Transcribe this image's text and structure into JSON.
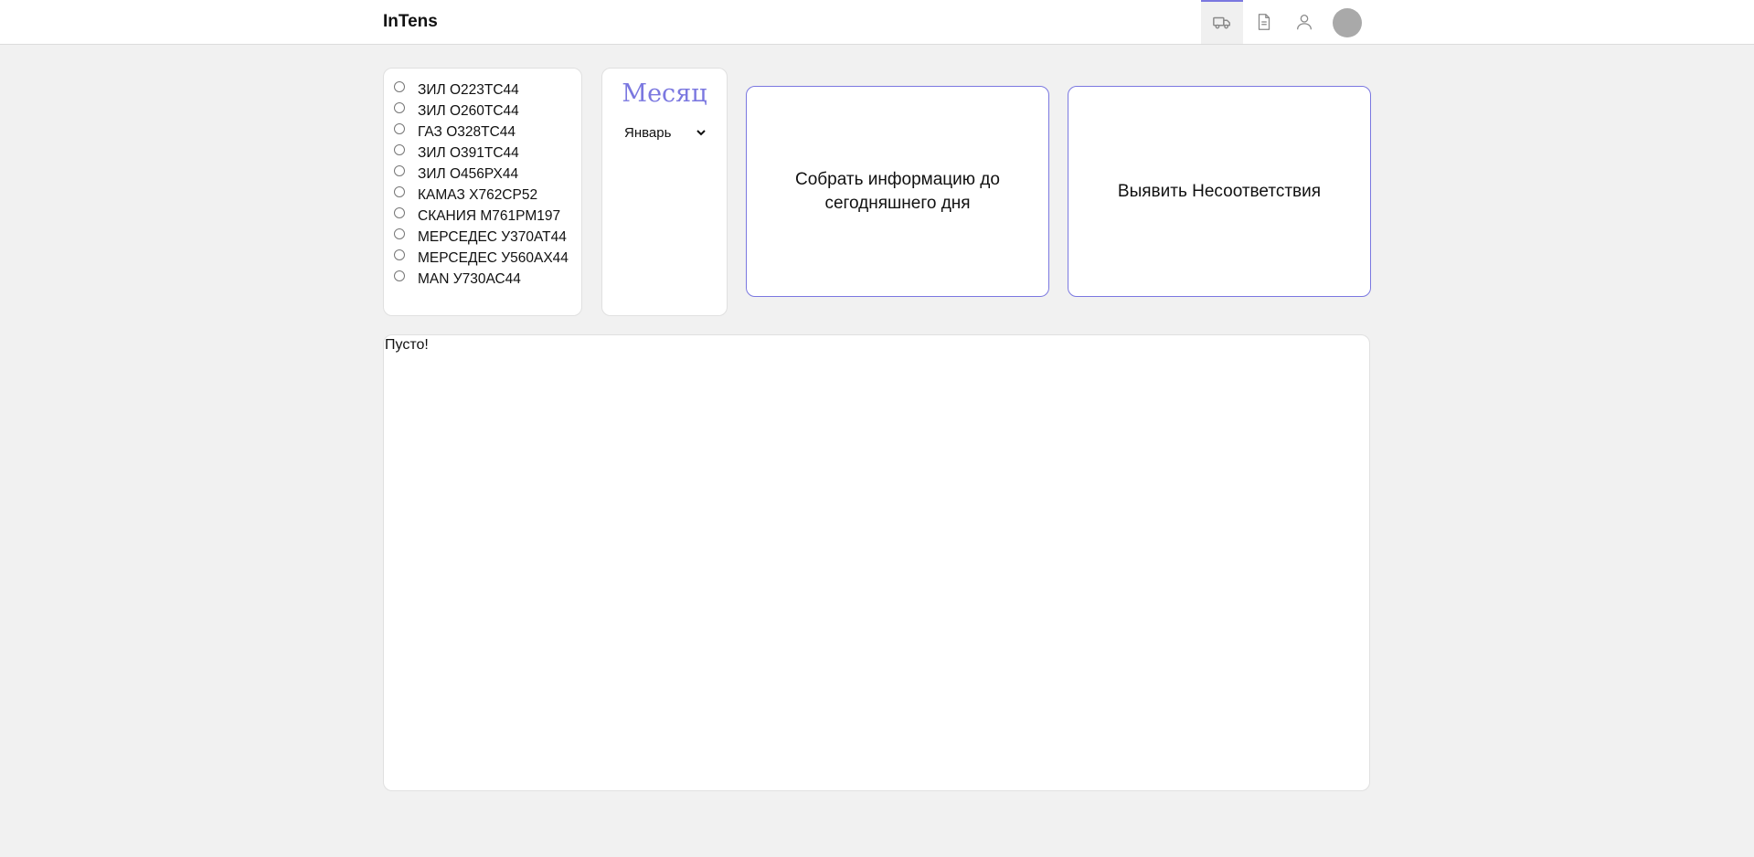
{
  "header": {
    "logo": "InTens",
    "nav": [
      {
        "name": "truck-icon",
        "active": true
      },
      {
        "name": "document-icon",
        "active": false
      },
      {
        "name": "user-icon",
        "active": false
      }
    ]
  },
  "vehicles": [
    "ЗИЛ О223ТС44",
    "ЗИЛ О260ТС44",
    "ГАЗ О328ТС44",
    "ЗИЛ О391ТС44",
    "ЗИЛ О456РХ44",
    "КАМАЗ Х762СР52",
    "СКАНИЯ М761РМ197",
    "МЕРСЕДЕС У370АТ44",
    "МЕРСЕДЕС У560АХ44",
    "MAN У730АС44"
  ],
  "month": {
    "title": "Месяц",
    "selected": "Январь"
  },
  "actions": {
    "collect_label": "Собрать информацию до сегодняшнего дня",
    "detect_label": "Выявить Несоответствия"
  },
  "results": {
    "text": "Пусто!"
  },
  "colors": {
    "accent": "#7b78e0",
    "background": "#f1f1f1",
    "avatar": "#a9a9a9"
  }
}
